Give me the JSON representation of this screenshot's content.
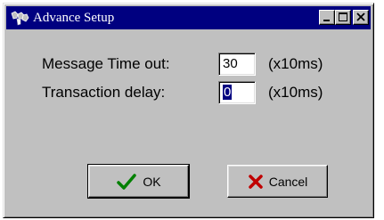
{
  "window": {
    "title": "Advance Setup",
    "titlebar_color": "#000080",
    "face_color": "#c0c0c0"
  },
  "titlebar_buttons": {
    "minimize_icon": "minimize-icon",
    "maximize_icon": "maximize-icon",
    "close_icon": "close-icon"
  },
  "form": {
    "message_timeout": {
      "label": "Message Time out:",
      "value": "30",
      "unit": "(x10ms)"
    },
    "transaction_delay": {
      "label": "Transaction delay:",
      "value": "0",
      "unit": "(x10ms)"
    }
  },
  "buttons": {
    "ok": {
      "label": "OK",
      "icon": "checkmark-icon",
      "icon_color": "#008000"
    },
    "cancel": {
      "label": "Cancel",
      "icon": "x-icon",
      "icon_color": "#c00000"
    }
  }
}
